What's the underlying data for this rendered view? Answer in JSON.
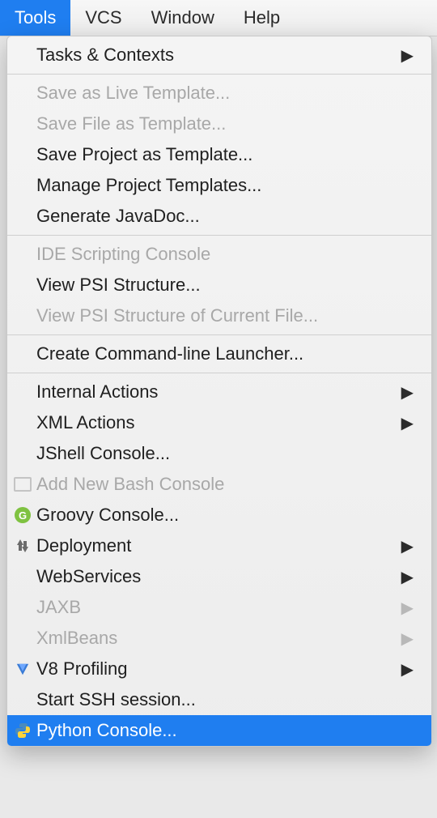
{
  "menubar": {
    "tools": "Tools",
    "vcs": "VCS",
    "window": "Window",
    "help": "Help"
  },
  "menu": {
    "tasks_contexts": "Tasks & Contexts",
    "save_live_template": "Save as Live Template...",
    "save_file_template": "Save File as Template...",
    "save_project_template": "Save Project as Template...",
    "manage_project_templates": "Manage Project Templates...",
    "generate_javadoc": "Generate JavaDoc...",
    "ide_scripting_console": "IDE Scripting Console",
    "view_psi_structure": "View PSI Structure...",
    "view_psi_current": "View PSI Structure of Current File...",
    "create_cli_launcher": "Create Command-line Launcher...",
    "internal_actions": "Internal Actions",
    "xml_actions": "XML Actions",
    "jshell_console": "JShell Console...",
    "add_bash_console": "Add New Bash Console",
    "groovy_console": "Groovy Console...",
    "deployment": "Deployment",
    "webservices": "WebServices",
    "jaxb": "JAXB",
    "xmlbeans": "XmlBeans",
    "v8_profiling": "V8 Profiling",
    "start_ssh": "Start SSH session...",
    "python_console": "Python Console..."
  },
  "icons": {
    "groovy_letter": "G"
  }
}
